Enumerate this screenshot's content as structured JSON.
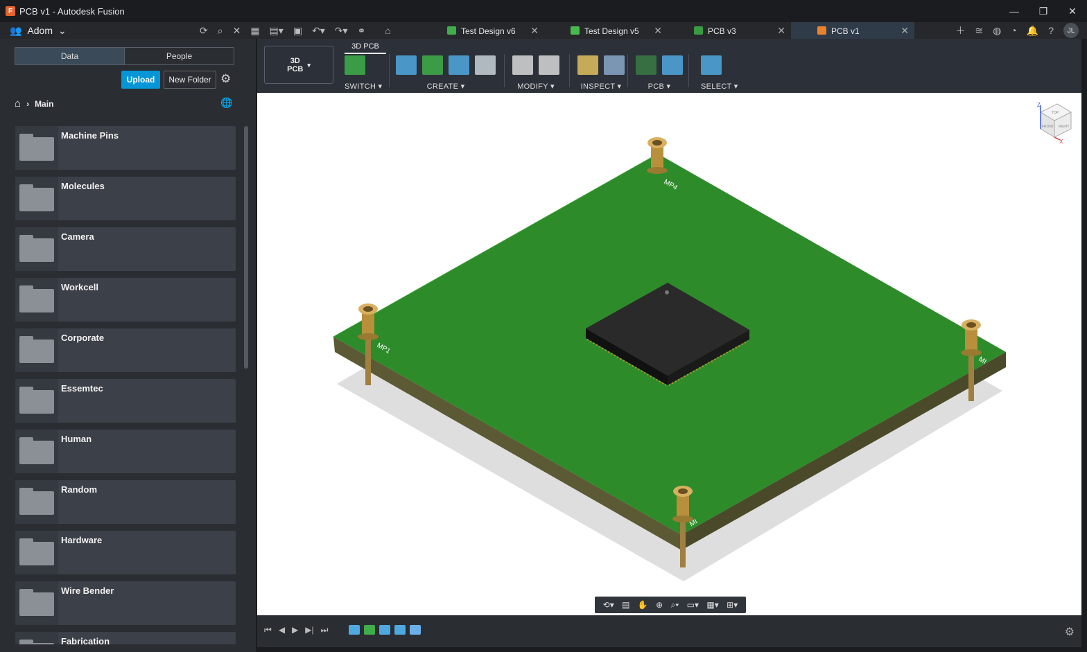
{
  "window": {
    "title": "PCB v1 - Autodesk Fusion",
    "app_icon_letter": "F",
    "min": "—",
    "restore": "❐",
    "close": "✕"
  },
  "topbar": {
    "team": "Adom",
    "tabs": [
      {
        "label": "Test Design v6",
        "color": "#3fae4a",
        "active": false
      },
      {
        "label": "Test Design v5",
        "color": "#48b94e",
        "active": false
      },
      {
        "label": "PCB v3",
        "color": "#3a9a44",
        "active": false
      },
      {
        "label": "PCB v1",
        "color": "#e8822c",
        "active": true
      }
    ],
    "avatar": "JL"
  },
  "panel": {
    "seg_data": "Data",
    "seg_people": "People",
    "upload": "Upload",
    "new_folder": "New Folder",
    "crumb": "Main",
    "folders": [
      "Machine Pins",
      "Molecules",
      "Camera",
      "Workcell",
      "Corporate",
      "Essemtec",
      "Human",
      "Random",
      "Hardware",
      "Wire Bender",
      "Fabrication"
    ]
  },
  "toolbar": {
    "workspace": "3D\nPCB",
    "workspace_line1": "3D",
    "workspace_line2": "PCB",
    "active_tab": "3D PCB",
    "groups": [
      {
        "label": "SWITCH ▾",
        "icons": [
          "#3fae4a"
        ]
      },
      {
        "label": "CREATE ▾",
        "icons": [
          "#4fa8e0",
          "#3fae4a",
          "#4fa8e0",
          "#c8d0d8"
        ]
      },
      {
        "label": "MODIFY ▾",
        "icons": [
          "#d8d8d8",
          "#d8d8d8"
        ]
      },
      {
        "label": "INSPECT ▾",
        "icons": [
          "#e0c060",
          "#8aa8c8"
        ]
      },
      {
        "label": "PCB ▾",
        "icons": [
          "#3a7a44",
          "#4fa8e0"
        ]
      },
      {
        "label": "SELECT ▾",
        "icons": [
          "#4fa8e0"
        ]
      }
    ]
  },
  "viewport": {
    "labels": {
      "mp4": "MP4",
      "mp1": "MP1",
      "mp2": "MI",
      "mp3": "MI"
    },
    "cube": {
      "top": "TOP",
      "front": "FRONT",
      "right": "RIGHT",
      "z": "Z",
      "x": "X"
    }
  },
  "colors": {
    "pcb_top": "#2e8b2a",
    "pcb_edge": "#5b5a34",
    "chip": "#2a2a2a",
    "pin": "#b8903c"
  }
}
